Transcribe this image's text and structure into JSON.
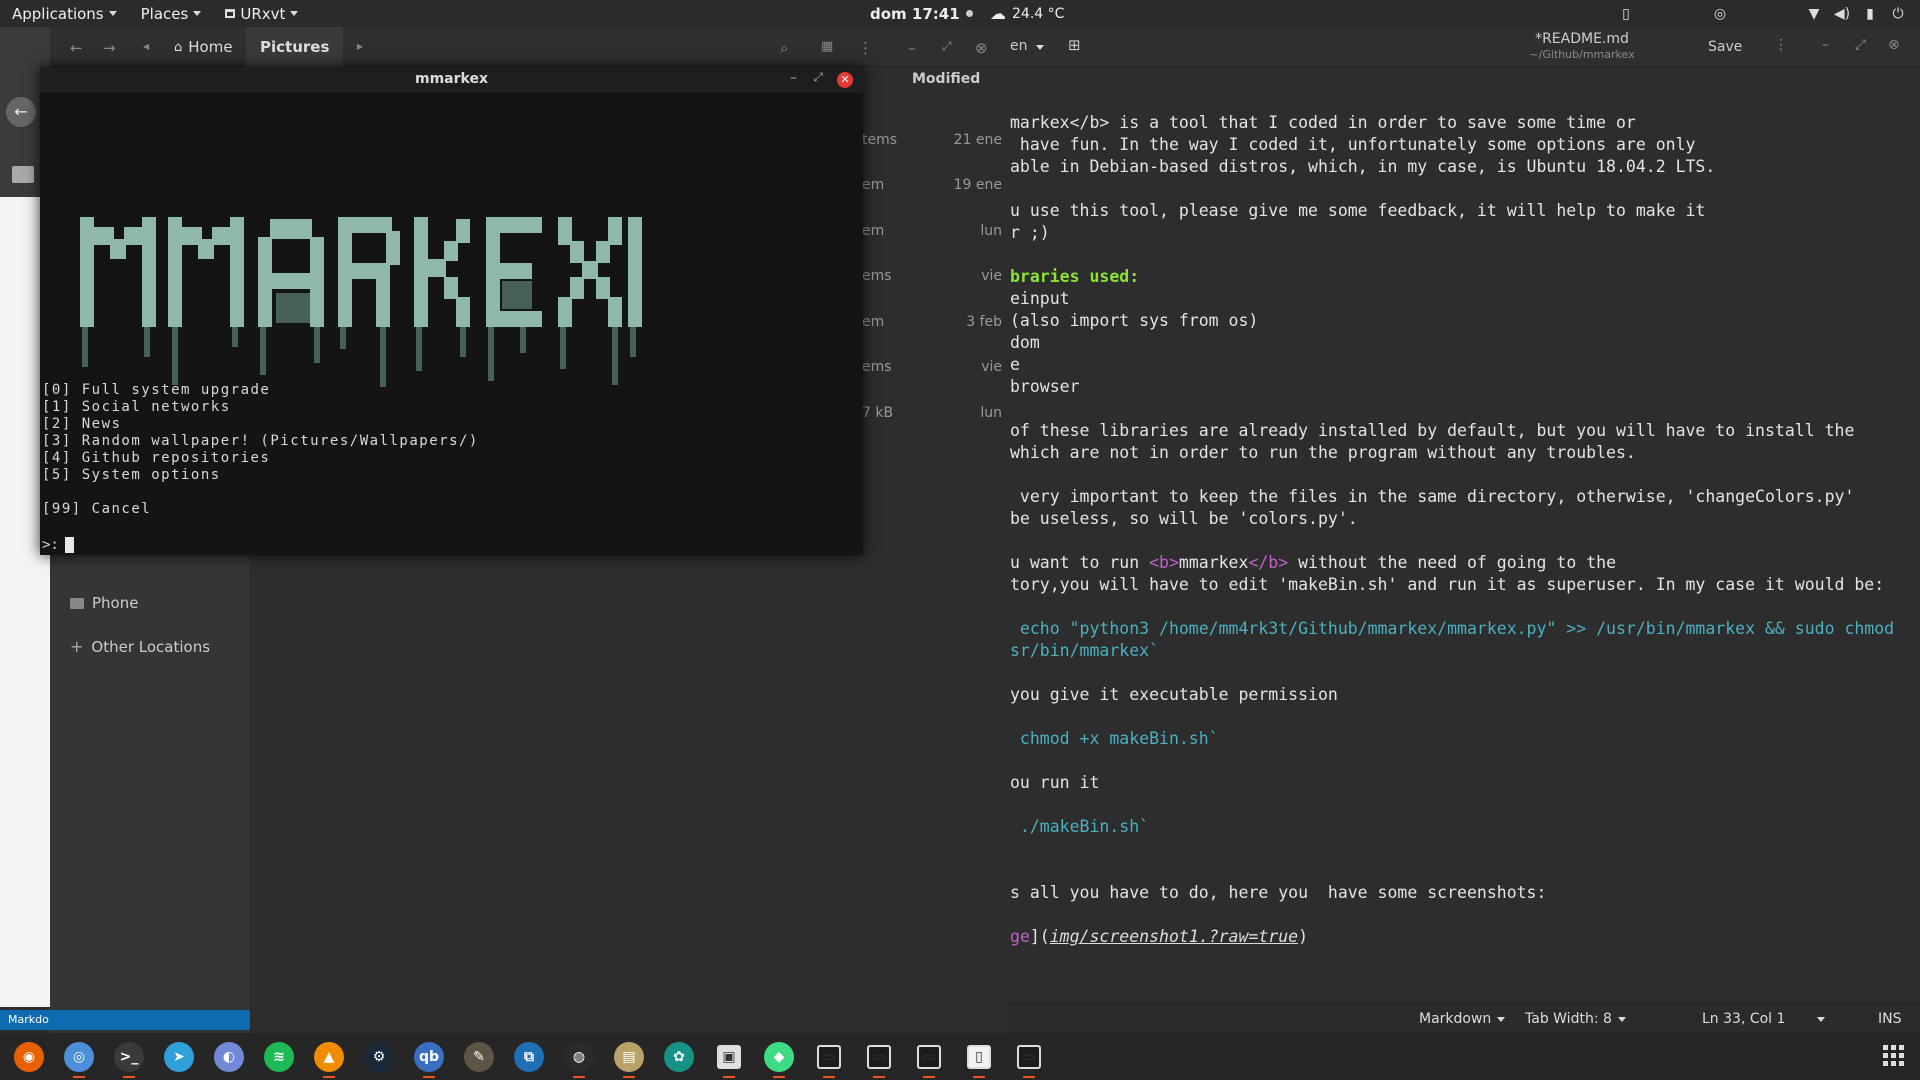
{
  "topbar": {
    "applications": "Applications",
    "places": "Places",
    "active_app": "URxvt",
    "clock": "dom 17:41",
    "weather": "24.4 °C"
  },
  "editor": {
    "tab_fragment": "en",
    "title": "*README.md",
    "subtitle": "~/Github/mmarkex",
    "save": "Save",
    "lines": {
      "l1": "markex</b> is a tool that I coded in order to save some time or",
      "l2": " have fun. In the way I coded it, unfortunately some options are only",
      "l3": "able in Debian-based distros, which, in my case, is Ubuntu 18.04.2 LTS.",
      "l5": "u use this tool, please give me some feedback, it will help to make it",
      "l6": "r ;)",
      "l8": "braries used:",
      "l9": "einput",
      "l10": "(also import sys from os)",
      "l11": "dom",
      "l12": "e",
      "l13": "browser",
      "l15": "of these libraries are already installed by default, but you will have to install the",
      "l16": "which are not in order to run the program without any troubles.",
      "l18": " very important to keep the files in the same directory, otherwise, 'changeColors.py'",
      "l19": "be useless, so will be 'colors.py'.",
      "l21a": "u want to run ",
      "l21b": "<b>",
      "l21c": "mmarkex",
      "l21d": "</b>",
      "l21e": " without the need of going to the",
      "l22": "tory,you will have to edit 'makeBin.sh' and run it as superuser. In my case it would be:",
      "l24": " echo \"python3 /home/mm4rk3t/Github/mmarkex/mmarkex.py\" >> /usr/bin/mmarkex && sudo chmod",
      "l25": "sr/bin/mmarkex`",
      "l27": "you give it executable permission",
      "l29": " chmod +x makeBin.sh`",
      "l31": "ou run it",
      "l33": " ./makeBin.sh`",
      "l36": "s all you have to do, here you  have some screenshots:",
      "l38a": "ge",
      "l38b": "](",
      "l38c": "img/screenshot1.?raw=true",
      "l38d": ")"
    },
    "status": {
      "language": "Markdown",
      "tab_width": "Tab Width: 8",
      "position": "Ln 33, Col 1",
      "mode": "INS"
    }
  },
  "files": {
    "home": "Home",
    "current": "Pictures",
    "sidebar": {
      "phone": "Phone",
      "other": "Other Locations"
    },
    "column_modified": "Modified",
    "rows": [
      {
        "a": "tems",
        "b": "21 ene"
      },
      {
        "a": "em",
        "b": "19 ene"
      },
      {
        "a": "em",
        "b": "lun"
      },
      {
        "a": "ems",
        "b": "vie"
      },
      {
        "a": "em",
        "b": "3 feb"
      },
      {
        "a": "ems",
        "b": "vie"
      },
      {
        "a": "7 kB",
        "b": "lun"
      }
    ],
    "statusbar": "Markdo"
  },
  "terminal": {
    "title": "mmarkex",
    "menu": [
      "[0] Full system upgrade",
      "[1] Social networks",
      "[2] News",
      "[3] Random wallpaper! (Pictures/Wallpapers/)",
      "[4] Github repositories",
      "[5] System options"
    ],
    "cancel": "[99] Cancel",
    "prompt": ">:"
  },
  "dock": {
    "apps": [
      "firefox",
      "chromium",
      "terminal",
      "telegram",
      "discord",
      "spotify",
      "vlc",
      "steam",
      "qbittorrent",
      "gimp",
      "vscode",
      "obs",
      "files",
      "gitkraken",
      "software-center",
      "android-studio",
      "window",
      "window",
      "window",
      "pdf-viewer",
      "window"
    ]
  },
  "colors": {
    "accent": "#e95420",
    "keyword": "#8ae234",
    "code": "#4ab0c0",
    "link": "#c061cb",
    "banner": "#8fb8a8"
  }
}
